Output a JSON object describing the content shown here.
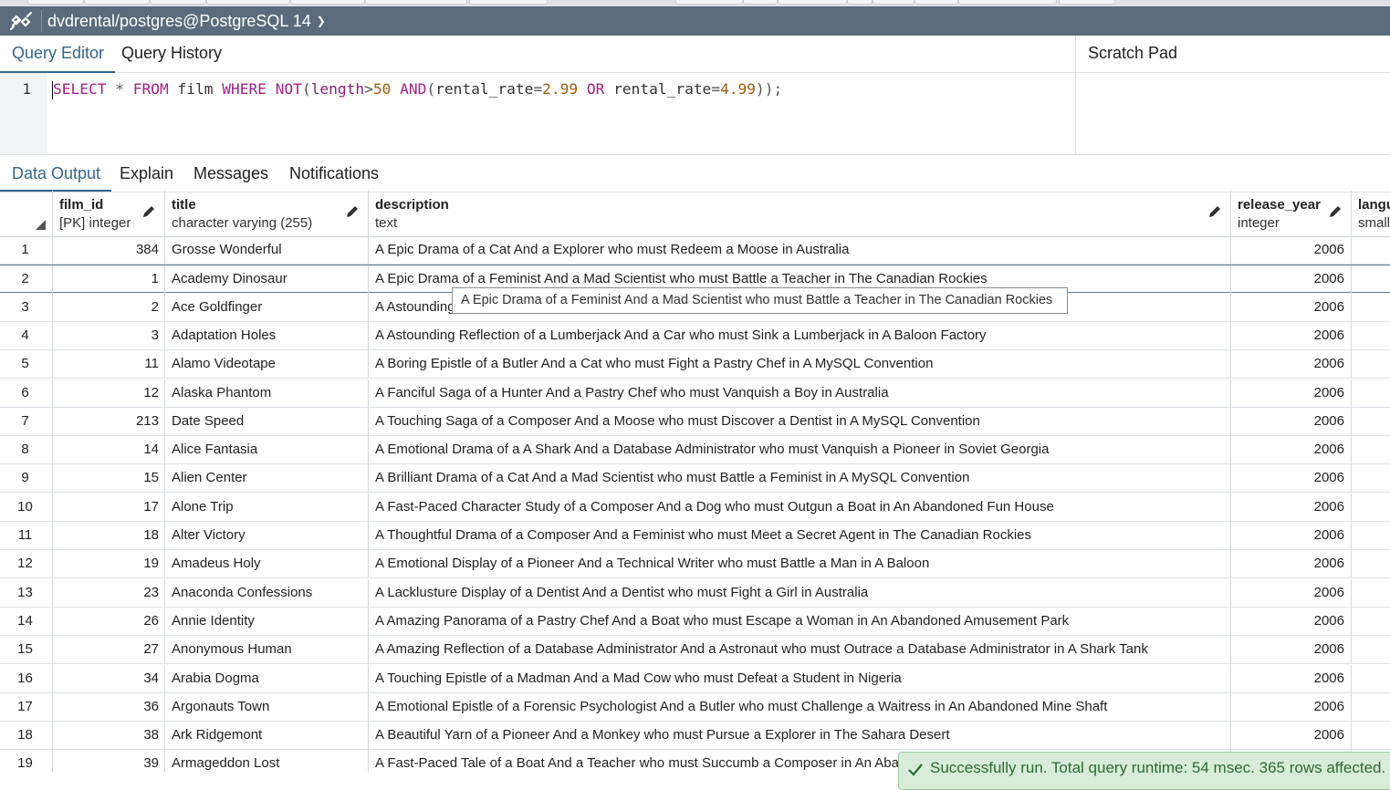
{
  "connection": {
    "title": "dvdrental/postgres@PostgreSQL 14"
  },
  "query_tabs": [
    "Query Editor",
    "Query History"
  ],
  "scratch_pad": {
    "label": "Scratch Pad"
  },
  "editor": {
    "line_number": "1",
    "tokens": {
      "select": "SELECT",
      "star": " * ",
      "from": "FROM",
      "table": " film ",
      "where": "WHERE",
      "sp1": " ",
      "not": "NOT",
      "lp1": "(",
      "length": "length",
      "gt": ">",
      "n50": "50",
      "sp2": " ",
      "and": "AND",
      "lp2": "(",
      "col1": "rental_rate",
      "eq1": "=",
      "n299": "2.99",
      "sp3": " ",
      "or": "OR",
      "col2": " rental_rate",
      "eq2": "=",
      "n499": "4.99",
      "tail": "));"
    }
  },
  "output_tabs": [
    "Data Output",
    "Explain",
    "Messages",
    "Notifications"
  ],
  "columns": [
    {
      "name": "film_id",
      "type": "[PK] integer"
    },
    {
      "name": "title",
      "type": "character varying (255)"
    },
    {
      "name": "description",
      "type": "text"
    },
    {
      "name": "release_year",
      "type": "integer"
    },
    {
      "name": "langu",
      "type": "small"
    }
  ],
  "rows": [
    {
      "idx": "1",
      "film_id": "384",
      "title": "Grosse Wonderful",
      "description": "A Epic Drama of a Cat And a Explorer who must Redeem a Moose in Australia",
      "release_year": "2006"
    },
    {
      "idx": "2",
      "film_id": "1",
      "title": "Academy Dinosaur",
      "description": "A Epic Drama of a Feminist And a Mad Scientist who must Battle a Teacher in The Canadian Rockies",
      "release_year": "2006"
    },
    {
      "idx": "3",
      "film_id": "2",
      "title": "Ace Goldfinger",
      "description": "A Astounding",
      "release_year": "2006"
    },
    {
      "idx": "4",
      "film_id": "3",
      "title": "Adaptation Holes",
      "description": "A Astounding Reflection of a Lumberjack And a Car who must Sink a Lumberjack in A Baloon Factory",
      "release_year": "2006"
    },
    {
      "idx": "5",
      "film_id": "11",
      "title": "Alamo Videotape",
      "description": "A Boring Epistle of a Butler And a Cat who must Fight a Pastry Chef in A MySQL Convention",
      "release_year": "2006"
    },
    {
      "idx": "6",
      "film_id": "12",
      "title": "Alaska Phantom",
      "description": "A Fanciful Saga of a Hunter And a Pastry Chef who must Vanquish a Boy in Australia",
      "release_year": "2006"
    },
    {
      "idx": "7",
      "film_id": "213",
      "title": "Date Speed",
      "description": "A Touching Saga of a Composer And a Moose who must Discover a Dentist in A MySQL Convention",
      "release_year": "2006"
    },
    {
      "idx": "8",
      "film_id": "14",
      "title": "Alice Fantasia",
      "description": "A Emotional Drama of a A Shark And a Database Administrator who must Vanquish a Pioneer in Soviet Georgia",
      "release_year": "2006"
    },
    {
      "idx": "9",
      "film_id": "15",
      "title": "Alien Center",
      "description": "A Brilliant Drama of a Cat And a Mad Scientist who must Battle a Feminist in A MySQL Convention",
      "release_year": "2006"
    },
    {
      "idx": "10",
      "film_id": "17",
      "title": "Alone Trip",
      "description": "A Fast-Paced Character Study of a Composer And a Dog who must Outgun a Boat in An Abandoned Fun House",
      "release_year": "2006"
    },
    {
      "idx": "11",
      "film_id": "18",
      "title": "Alter Victory",
      "description": "A Thoughtful Drama of a Composer And a Feminist who must Meet a Secret Agent in The Canadian Rockies",
      "release_year": "2006"
    },
    {
      "idx": "12",
      "film_id": "19",
      "title": "Amadeus Holy",
      "description": "A Emotional Display of a Pioneer And a Technical Writer who must Battle a Man in A Baloon",
      "release_year": "2006"
    },
    {
      "idx": "13",
      "film_id": "23",
      "title": "Anaconda Confessions",
      "description": "A Lacklusture Display of a Dentist And a Dentist who must Fight a Girl in Australia",
      "release_year": "2006"
    },
    {
      "idx": "14",
      "film_id": "26",
      "title": "Annie Identity",
      "description": "A Amazing Panorama of a Pastry Chef And a Boat who must Escape a Woman in An Abandoned Amusement Park",
      "release_year": "2006"
    },
    {
      "idx": "15",
      "film_id": "27",
      "title": "Anonymous Human",
      "description": "A Amazing Reflection of a Database Administrator And a Astronaut who must Outrace a Database Administrator in A Shark Tank",
      "release_year": "2006"
    },
    {
      "idx": "16",
      "film_id": "34",
      "title": "Arabia Dogma",
      "description": "A Touching Epistle of a Madman And a Mad Cow who must Defeat a Student in Nigeria",
      "release_year": "2006"
    },
    {
      "idx": "17",
      "film_id": "36",
      "title": "Argonauts Town",
      "description": "A Emotional Epistle of a Forensic Psychologist And a Butler who must Challenge a Waitress in An Abandoned Mine Shaft",
      "release_year": "2006"
    },
    {
      "idx": "18",
      "film_id": "38",
      "title": "Ark Ridgemont",
      "description": "A Beautiful Yarn of a Pioneer And a Monkey who must Pursue a Explorer in The Sahara Desert",
      "release_year": "2006"
    },
    {
      "idx": "19",
      "film_id": "39",
      "title": "Armageddon Lost",
      "description": "A Fast-Paced Tale of a Boat And a Teacher who must Succumb a Composer in An Aban",
      "release_year": ""
    }
  ],
  "tooltip": {
    "text": "A Epic Drama of a Feminist And a Mad Scientist who must Battle a Teacher in The Canadian Rockies"
  },
  "toast": {
    "text": "Successfully run. Total query runtime: 54 msec. 365 rows affected."
  },
  "colors": {
    "header_bar": "#5b6b7d",
    "accent": "#326690",
    "success_bg": "#d7ecd9"
  },
  "icons": [
    "connection-icon",
    "chevron-down-icon",
    "pencil-icon",
    "check-icon",
    "sort-triangle-icon"
  ]
}
